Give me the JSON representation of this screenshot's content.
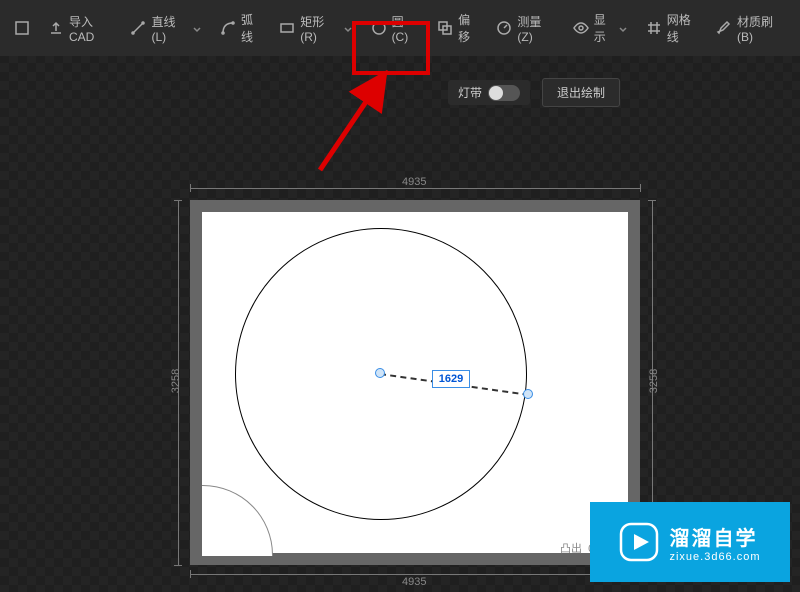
{
  "toolbar": {
    "import_cad": "导入CAD",
    "line": "直线 (L)",
    "arc": "弧线",
    "rect": "矩形 (R)",
    "circle": "圆 (C)",
    "offset": "偏移",
    "measure": "测量 (Z)",
    "display": "显示",
    "grid": "网格线",
    "material": "材质刷 (B)"
  },
  "secondary": {
    "light_strip": "灯带",
    "exit": "退出绘制"
  },
  "dims": {
    "top": "4935",
    "bottom": "4935",
    "left": "3258",
    "right": "3258"
  },
  "radius_value": "1629",
  "extrude": {
    "label": "凸出",
    "value": "0"
  },
  "watermark": {
    "main": "溜溜自学",
    "sub": "zixue.3d66.com"
  }
}
